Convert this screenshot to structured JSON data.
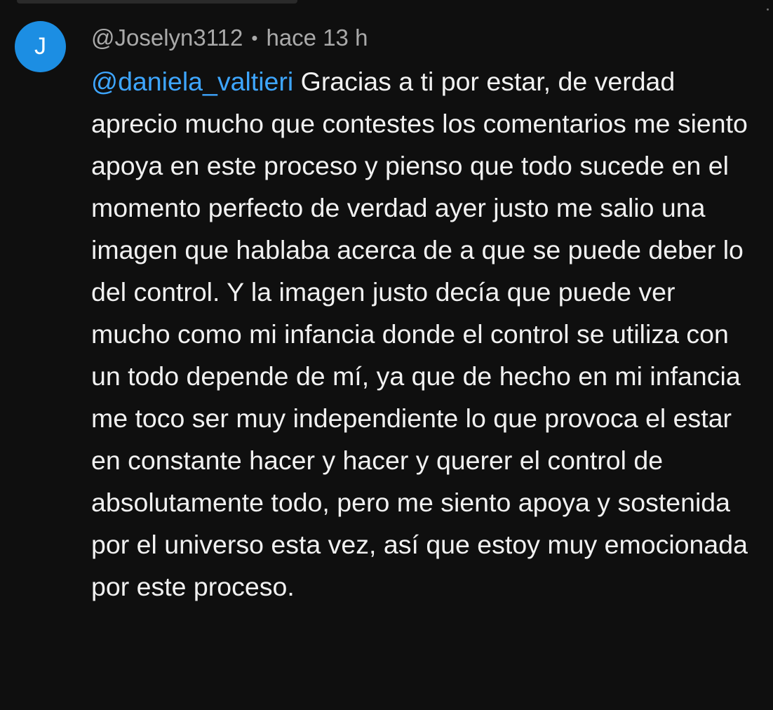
{
  "comment": {
    "avatar_letter": "J",
    "avatar_color": "#1c8ee3",
    "author": "@Joselyn3112",
    "separator": "•",
    "time": "hace 13 h",
    "mention": "@daniela_valtieri",
    "text": " Gracias a ti por estar, de verdad aprecio mucho que contestes los comentarios me siento apoya en este proceso y pienso que todo sucede en el momento perfecto de verdad ayer justo me salio una imagen que hablaba acerca de a que se puede deber lo del control. Y la imagen justo decía que puede ver mucho como mi infancia donde el control se utiliza con un todo depende de mí, ya que de hecho en mi infancia me toco ser muy independiente lo que provoca el estar en constante hacer y hacer y querer el control de absolutamente todo, pero me siento apoya y sostenida por el universo esta vez, así que estoy muy emocionada por este proceso."
  },
  "colors": {
    "background": "#0f0f0f",
    "mention": "#3ea6ff",
    "meta_text": "#aaaaaa",
    "body_text": "#f1f1f1"
  }
}
